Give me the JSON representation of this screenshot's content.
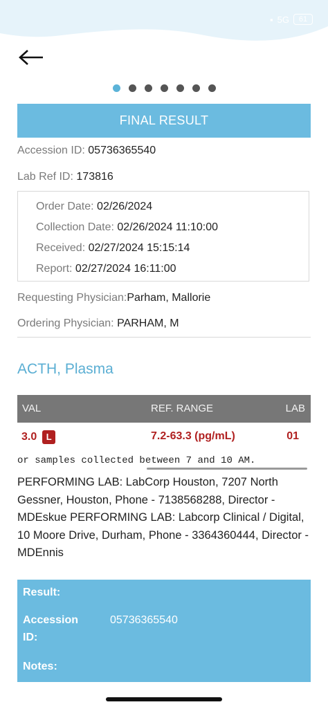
{
  "status_bar": {
    "network": "5G",
    "battery": "61"
  },
  "carousel": {
    "total": 7,
    "active": 0
  },
  "banner": {
    "title": "FINAL RESULT"
  },
  "details": {
    "accession_label": "Accession ID:",
    "accession_value": "05736365540",
    "labref_label": "Lab Ref ID:",
    "labref_value": "173816",
    "order_label": "Order Date:",
    "order_value": "02/26/2024",
    "collection_label": "Collection Date:",
    "collection_value": "02/26/2024 11:10:00",
    "received_label": "Received:",
    "received_value": "02/27/2024 15:15:14",
    "report_label": "Report:",
    "report_value": "02/27/2024  16:11:00",
    "requesting_label": "Requesting Physician:",
    "requesting_value": "Parham, Mallorie",
    "ordering_label": "Ordering Physician:",
    "ordering_value": "PARHAM, M"
  },
  "test": {
    "name": "ACTH, Plasma",
    "headers": {
      "val": "VAL",
      "ref": "REF. RANGE",
      "lab": "LAB"
    },
    "value": "3.0",
    "flag": "L",
    "ref_range": "7.2-63.3 (pg/mL)",
    "lab": "01",
    "comment_line": "or samples collected between 7 and 10 AM.",
    "performing_lab": "PERFORMING LAB: LabCorp Houston, 7207 North Gessner, Houston, Phone - 7138568288, Director - MDEskue PERFORMING LAB: Labcorp Clinical / Digital, 10 Moore Drive, Durham, Phone - 3364360444, Director - MDEnnis"
  },
  "result_panel": {
    "result_label": "Result:",
    "accession_label_1": "Accession",
    "accession_label_2": "ID:",
    "accession_value": "05736365540",
    "notes_label": "Notes:"
  },
  "colors": {
    "accent": "#6bbbe0",
    "flag_red": "#b02020",
    "header_gray": "#777777"
  }
}
